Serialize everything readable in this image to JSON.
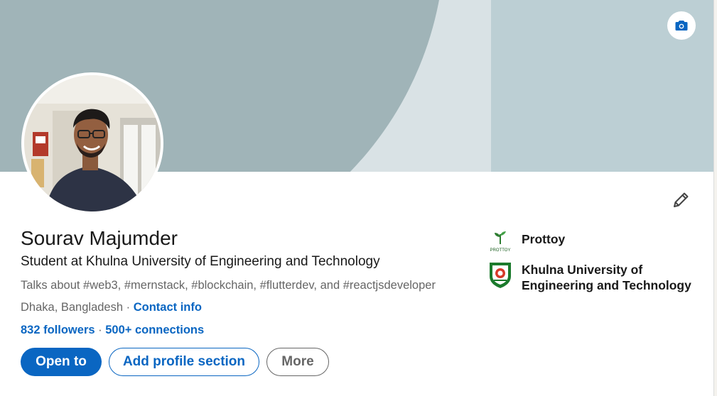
{
  "cover": {
    "camera_label": "camera"
  },
  "profile": {
    "name": "Sourav Majumder",
    "headline": "Student at Khulna University of Engineering and Technology",
    "talks_about": "Talks about #web3, #mernstack, #blockchain, #flutterdev, and #reactjsdeveloper",
    "location": "Dhaka, Bangladesh",
    "location_sep": " · ",
    "contact_info": "Contact info",
    "followers": "832 followers",
    "stats_sep": " · ",
    "connections": "500+ connections"
  },
  "actions": {
    "open_to": "Open to",
    "add_section": "Add profile section",
    "more": "More"
  },
  "organizations": [
    {
      "name": "Prottoy",
      "logo_text": "PROTTOY",
      "icon": "prottoy-logo"
    },
    {
      "name_line1": "Khulna University of",
      "name_line2": "Engineering and Technology",
      "icon": "kuet-logo"
    }
  ],
  "colors": {
    "brand_blue": "#0a66c2",
    "cover_left": "#a0b4b8",
    "cover_right": "#bccfd4",
    "cover_mid": "#d9e2e5"
  }
}
